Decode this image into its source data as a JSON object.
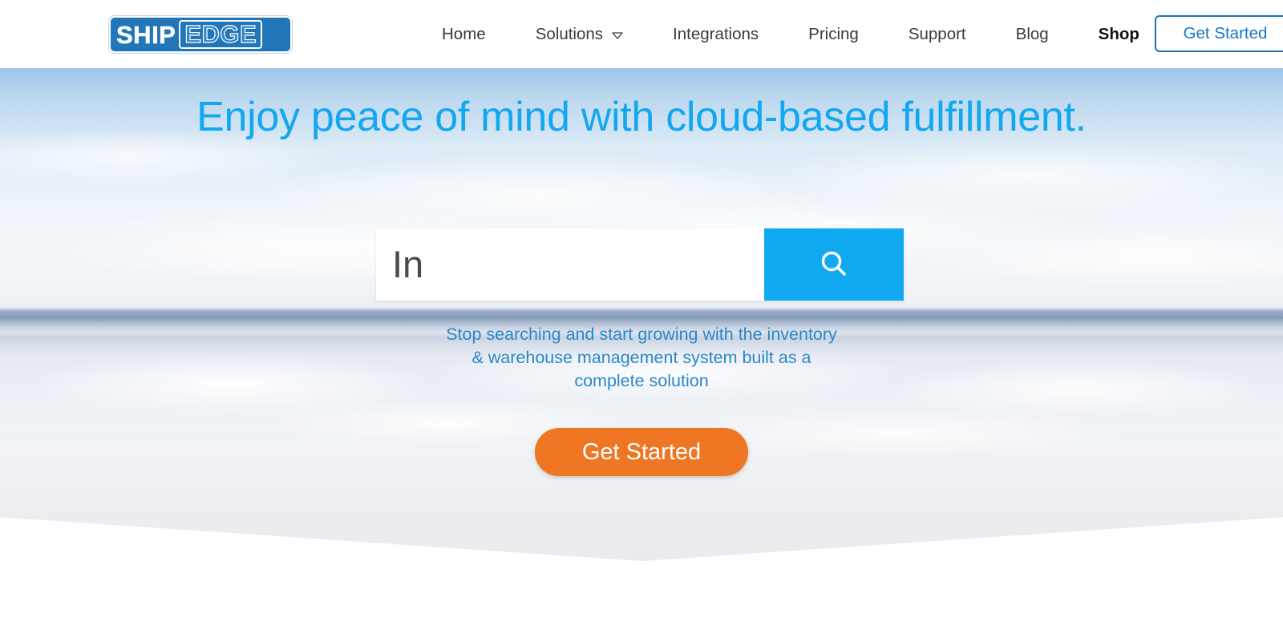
{
  "header": {
    "logo": {
      "part1": "SHIP",
      "part2": "EDGE",
      "name": "Shipedge"
    },
    "nav": [
      {
        "label": "Home",
        "active": false,
        "has_caret": false
      },
      {
        "label": "Solutions",
        "active": false,
        "has_caret": true
      },
      {
        "label": "Integrations",
        "active": false,
        "has_caret": false
      },
      {
        "label": "Pricing",
        "active": false,
        "has_caret": false
      },
      {
        "label": "Support",
        "active": false,
        "has_caret": false
      },
      {
        "label": "Blog",
        "active": false,
        "has_caret": false
      },
      {
        "label": "Shop",
        "active": true,
        "has_caret": false
      }
    ],
    "cta_label": "Get Started"
  },
  "hero": {
    "headline": "Enjoy peace of mind with cloud-based fulfillment.",
    "search": {
      "value": "In",
      "placeholder": "",
      "button_icon": "search-icon"
    },
    "subtitle_lines": [
      "Stop searching and start growing with the inventory",
      "& warehouse management system built as a",
      "complete solution"
    ],
    "cta_label": "Get Started"
  },
  "colors": {
    "brand_blue": "#11aaf0",
    "headline_blue": "#13a7ef",
    "subtitle_blue": "#2a87c9",
    "logo_blue": "#2076b8",
    "orange": "#ef7622",
    "outline_blue": "#1a73b8",
    "nav_text": "#3b3b3b"
  }
}
